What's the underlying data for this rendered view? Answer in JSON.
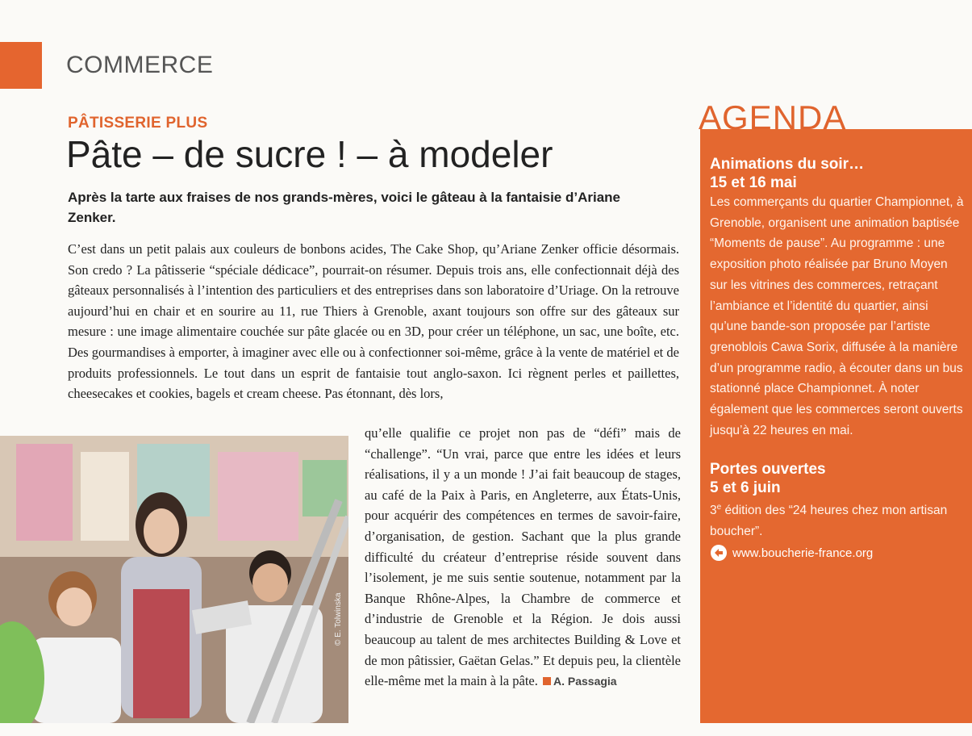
{
  "section": {
    "label": "COMMERCE"
  },
  "article": {
    "kicker": "PÂTISSERIE PLUS",
    "headline": "Pâte – de sucre ! – à modeler",
    "chapo": "Après la tarte aux fraises de nos grands-mères, voici le gâteau à la fantaisie d’Ariane Zenker.",
    "body_part1": "C’est dans un petit palais aux couleurs de bonbons acides, The Cake Shop, qu’Ariane Zenker officie désormais. Son credo ? La pâtisserie “spéciale dédicace”, pourrait-on résumer. Depuis trois ans, elle confectionnait déjà des gâteaux personnalisés à l’intention des particuliers et des entreprises dans son laboratoire d’Uriage. On la retrouve aujourd’hui en chair et en sourire au 11, rue Thiers à Grenoble, axant toujours son offre sur des gâteaux sur mesure : une image alimentaire couchée sur pâte glacée ou en 3D, pour créer un téléphone, un sac, une boîte, etc. Des gourmandises à emporter, à imaginer avec elle ou à confectionner soi-même, grâce à la vente de matériel et de produits professionnels. Le tout dans un esprit de fantaisie tout anglo-saxon. Ici règnent perles et paillettes, cheesecakes et cookies, bagels et cream cheese. Pas étonnant, dès lors,",
    "body_part2": "qu’elle qualifie ce projet non pas de “défi” mais de “challenge”. “Un vrai, parce que entre les idées et leurs réalisations, il y a un monde ! J’ai fait beaucoup de stages, au café de la Paix à Paris, en Angleterre, aux États-Unis, pour acquérir des compétences en termes de savoir-faire, d’organisation, de gestion. Sachant que la plus grande difficulté du créateur d’entreprise réside souvent dans l’isolement, je me suis sentie soutenue, notamment par la Banque Rhône-Alpes, la Chambre de commerce et d’industrie de Grenoble et la Région. Je dois aussi beaucoup au talent de mes architectes Building & Love et de mon pâtissier, Gaëtan Gelas.” Et depuis peu, la clientèle elle-même met la main à la pâte.",
    "author": "A. Passagia",
    "photo_credit": "© E. Tolwinska"
  },
  "agenda": {
    "title": "AGENDA",
    "event1": {
      "title": "Animations du soir…",
      "date": "15 et 16 mai",
      "text": "Les commerçants du quartier Championnet, à Grenoble, organisent une animation baptisée “Moments de pause”. Au programme : une exposition photo réalisée par Bruno Moyen sur les vitrines des commerces, retraçant l’ambiance et l’identité du quartier, ainsi qu’une bande-son proposée par l’artiste grenoblois Cawa Sorix, diffusée à la manière d’un programme radio, à écouter dans un bus stationné place Championnet. À noter également que les commerces seront ouverts jusqu’à 22 heures en mai."
    },
    "event2": {
      "title": "Portes ouvertes",
      "date": "5 et 6 juin",
      "edition_num": "3",
      "edition_sup": "e",
      "text": " édition des “24 heures chez mon artisan boucher”.",
      "link": "www.boucherie-france.org"
    }
  },
  "colors": {
    "accent": "#e46830",
    "text": "#222222"
  }
}
